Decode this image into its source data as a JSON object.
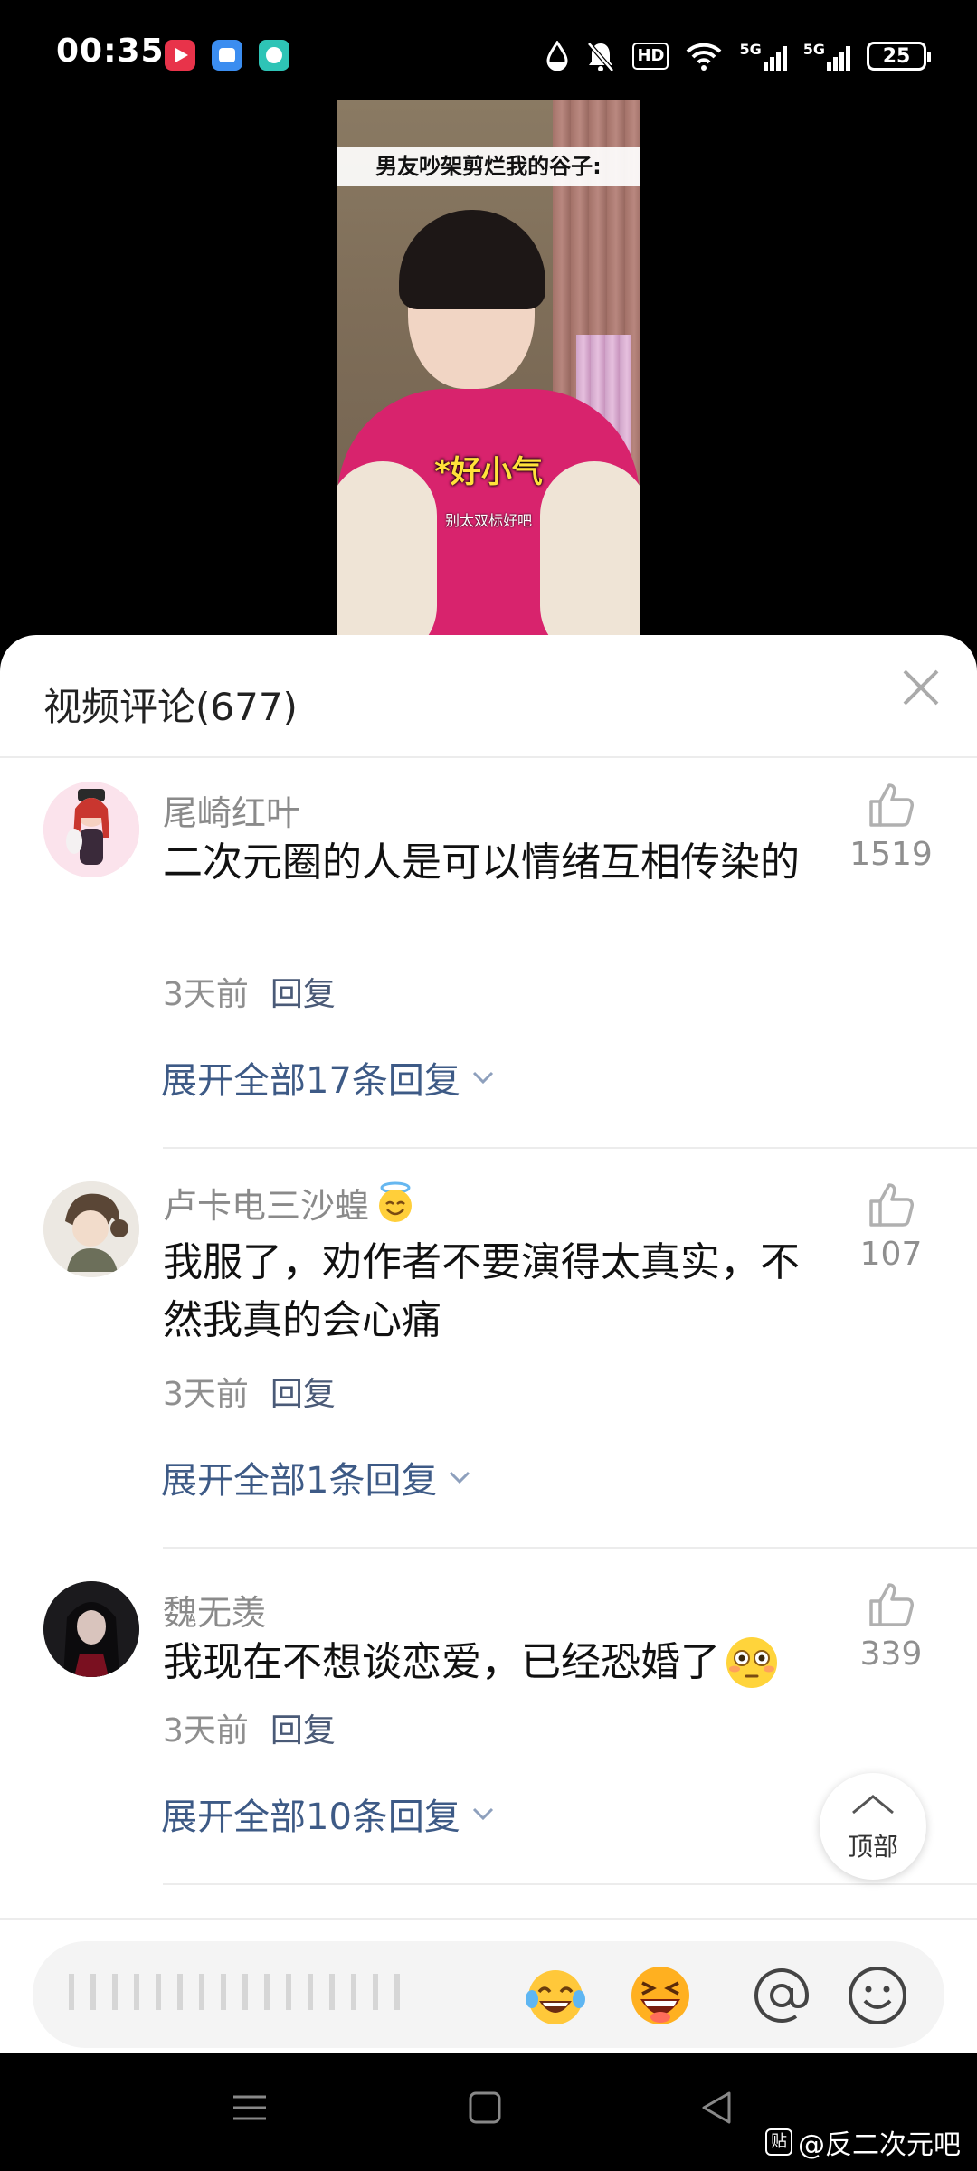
{
  "status_bar": {
    "time": "00:35",
    "hd_label": "HD",
    "net1": "5G",
    "net2": "5G",
    "battery": "25"
  },
  "video": {
    "caption": "男友吵架剪烂我的谷子:",
    "subtitle_main": "*好小气",
    "subtitle_small": "别太双标好吧"
  },
  "comments_sheet": {
    "title": "视频评论(677)",
    "comments": [
      {
        "user": "尾崎红叶",
        "text": "二次元圈的人是可以情绪互相传染的",
        "time": "3天前",
        "reply_label": "回复",
        "expand": "展开全部17条回复",
        "likes": "1519"
      },
      {
        "user": "卢卡电三沙蝗",
        "text": "我服了，劝作者不要演得太真实，不然我真的会心痛",
        "time": "3天前",
        "reply_label": "回复",
        "expand": "展开全部1条回复",
        "likes": "107"
      },
      {
        "user": "魏无羡",
        "text": "我现在不想谈恋爱，已经恐婚了",
        "time": "3天前",
        "reply_label": "回复",
        "expand": "展开全部10条回复",
        "likes": "339"
      }
    ],
    "top_button": "顶部"
  },
  "watermark": {
    "logo": "贴",
    "text": "@反二次元吧"
  },
  "colors": {
    "link_blue": "#3d5a86",
    "muted_gray": "#8f8f8f",
    "text_dark": "#111111"
  },
  "icons": {
    "close": "close-icon",
    "like": "thumbs-up-icon",
    "at": "at-sign-icon",
    "emoji": "smiley-icon"
  }
}
